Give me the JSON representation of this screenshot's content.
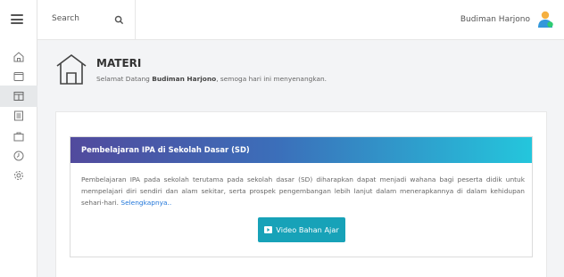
{
  "topbar": {
    "search_label": "Search",
    "user_name": "Budiman Harjono"
  },
  "sidebar": {
    "items": [
      {
        "icon": "home-icon"
      },
      {
        "icon": "window-icon"
      },
      {
        "icon": "layout-icon"
      },
      {
        "icon": "list-icon"
      },
      {
        "icon": "briefcase-icon"
      },
      {
        "icon": "clock-icon"
      },
      {
        "icon": "gear-icon"
      }
    ]
  },
  "header": {
    "title": "MATERI",
    "greeting_prefix": "Selamat Datang",
    "greeting_name": "Budiman Harjono",
    "greeting_suffix": ", semoga hari ini menyenangkan."
  },
  "material": {
    "title": "Pembelajaran IPA di Sekolah Dasar (SD)",
    "description": "Pembelajaran IPA pada sekolah terutama pada sekolah dasar (SD) diharapkan dapat menjadi wahana bagi peserta didik untuk mempelajari diri sendiri dan alam sekitar, serta prospek pengembangan lebih lanjut dalam menerapkannya di dalam kehidupan sehari-hari.",
    "read_more": "Selengkapnya..",
    "video_button": "Video Bahan Ajar"
  },
  "colors": {
    "accent": "#17a2b8",
    "gradient_start": "#514a9d",
    "gradient_end": "#24c6dc",
    "link": "#2176d9"
  }
}
